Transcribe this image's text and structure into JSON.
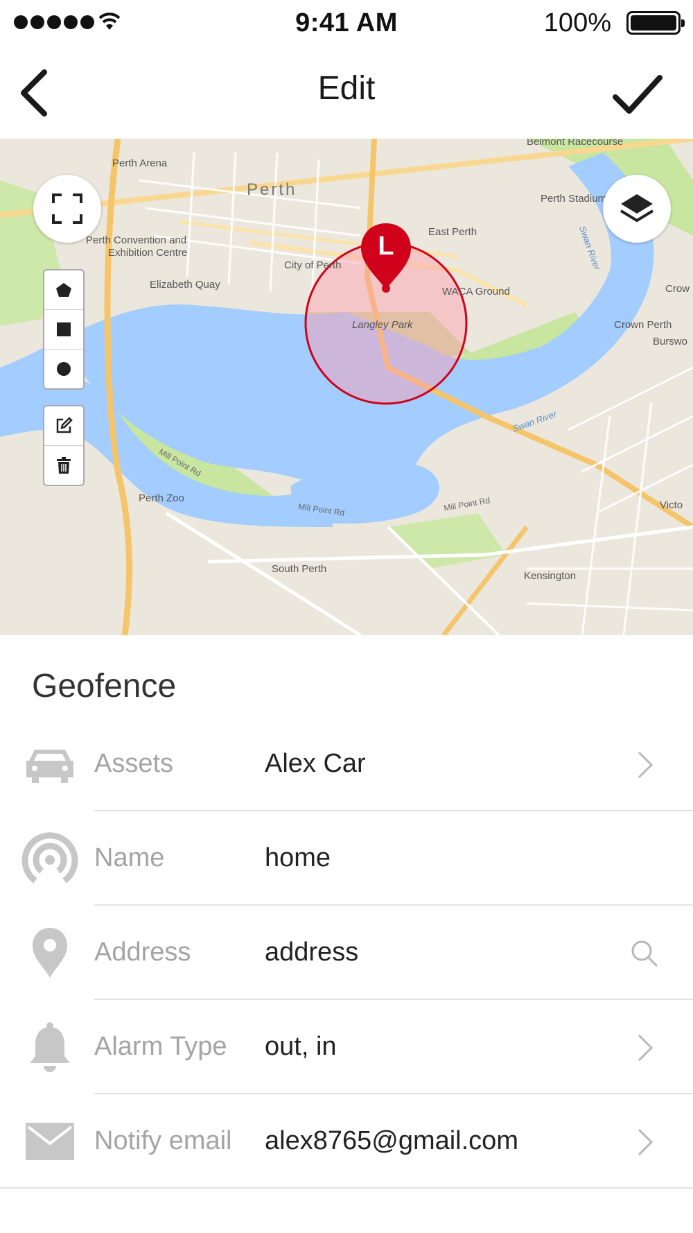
{
  "status_bar": {
    "time": "9:41 AM",
    "battery": "100%"
  },
  "nav": {
    "title": "Edit"
  },
  "map": {
    "labels": {
      "perth": "Perth",
      "perth_arena": "Perth Arena",
      "perth_stadium": "Perth Stadium",
      "convention": "Perth Convention and",
      "convention2": "Exhibition Centre",
      "city_of_perth": "City of Perth",
      "elizabeth_quay": "Elizabeth Quay",
      "east_perth": "East Perth",
      "waca": "WACA Ground",
      "langley_park": "Langley Park",
      "crown_perth": "Crown Perth",
      "burswood": "Burswo",
      "crown": "Crow",
      "victoria": "Victoria",
      "swan_river": "Swan River",
      "swan_river2": "Swan River",
      "perth_zoo": "Perth Zoo",
      "south_perth": "South Perth",
      "kensington": "Kensington",
      "mill_point_rd": "Mill Point Rd",
      "mill_point_rd2": "Mill Point Rd",
      "mill_point_rd3": "Mill Point Rd",
      "belmont": "Belmont Racecourse",
      "victo": "Victo"
    },
    "marker_letter": "L"
  },
  "geofence": {
    "title": "Geofence",
    "rows": [
      {
        "label": "Assets",
        "value": "Alex Car",
        "icon": "car-icon",
        "trail": "chevron-right-icon"
      },
      {
        "label": "Name",
        "value": "home",
        "icon": "signal-icon",
        "trail": ""
      },
      {
        "label": "Address",
        "value": "address",
        "icon": "location-pin-icon",
        "trail": "search-icon"
      },
      {
        "label": "Alarm Type",
        "value": "out, in",
        "icon": "bell-icon",
        "trail": "chevron-right-icon"
      },
      {
        "label": "Notify email",
        "value": "alex8765@gmail.com",
        "icon": "envelope-icon",
        "trail": "chevron-right-icon"
      }
    ]
  },
  "colors": {
    "accent": "#d0021b",
    "icon_gray": "#c7c7c7",
    "water": "#a3ccff",
    "park": "#c8e6a0"
  }
}
